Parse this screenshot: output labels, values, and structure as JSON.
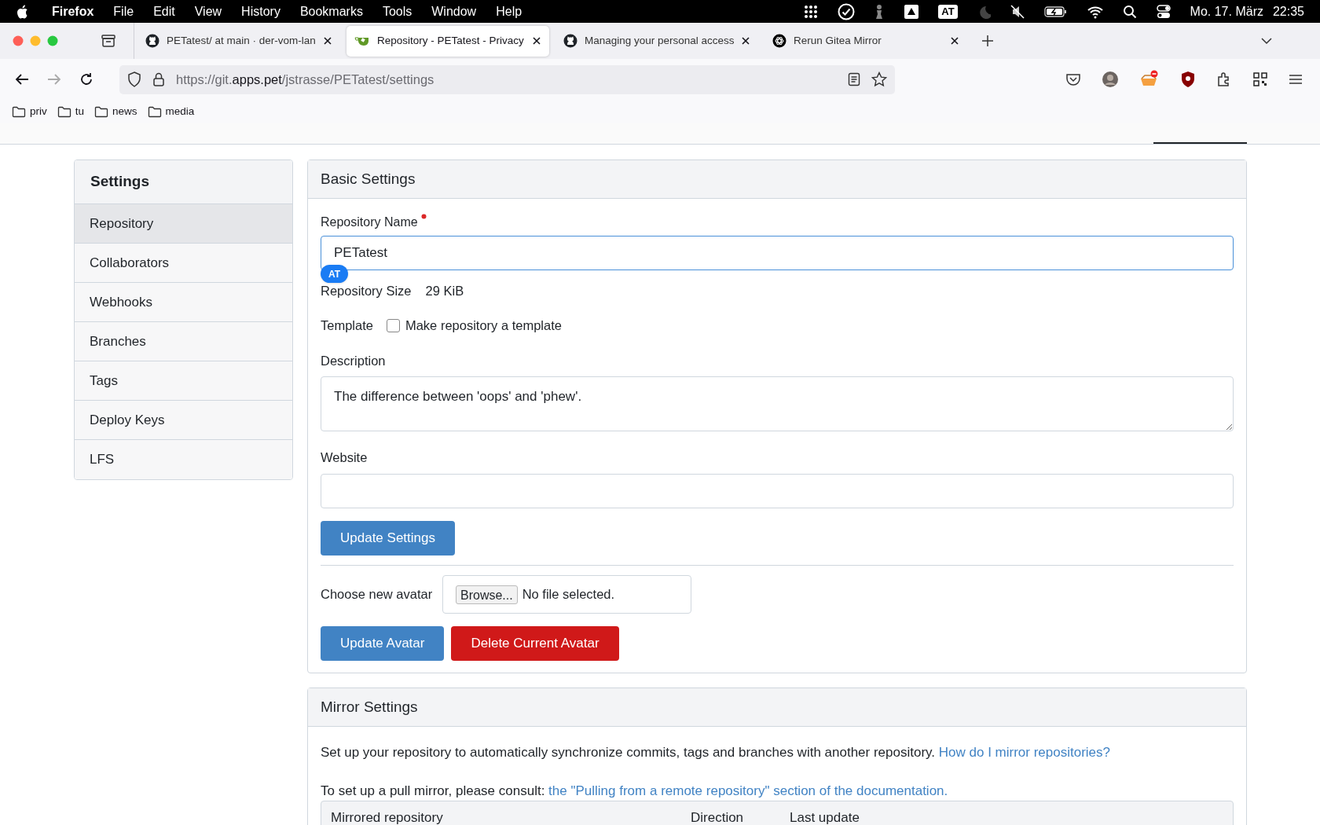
{
  "menu_bar": {
    "app": "Firefox",
    "items": [
      "File",
      "Edit",
      "View",
      "History",
      "Bookmarks",
      "Tools",
      "Window",
      "Help"
    ],
    "status_badge": "AT",
    "date": "Mo. 17. März",
    "time": "22:35"
  },
  "tabs": [
    {
      "title": "PETatest/ at main · der-vom-lan",
      "kind": "github",
      "selected": false
    },
    {
      "title": "Repository - PETatest - Privacy",
      "kind": "gitea",
      "selected": true
    },
    {
      "title": "Managing your personal access",
      "kind": "github",
      "selected": false
    },
    {
      "title": "Rerun Gitea Mirror",
      "kind": "knot",
      "selected": false
    }
  ],
  "address_bar": {
    "prefix": "https://git.",
    "domain": "apps.pet",
    "path": "/jstrasse/PETatest/settings"
  },
  "bookmarks": [
    "priv",
    "tu",
    "news",
    "media"
  ],
  "sidebar": {
    "title": "Settings",
    "items": [
      {
        "label": "Repository",
        "selected": true
      },
      {
        "label": "Collaborators",
        "selected": false
      },
      {
        "label": "Webhooks",
        "selected": false
      },
      {
        "label": "Branches",
        "selected": false
      },
      {
        "label": "Tags",
        "selected": false
      },
      {
        "label": "Deploy Keys",
        "selected": false
      },
      {
        "label": "LFS",
        "selected": false
      }
    ]
  },
  "basic_settings": {
    "title": "Basic Settings",
    "name_label": "Repository Name",
    "required": true,
    "name_value": "PETatest",
    "overlay_badge": "AT",
    "size_label": "Repository Size",
    "size_value": "29 KiB",
    "template_label": "Template",
    "template_checkbox": {
      "label": "Make repository a template",
      "checked": false
    },
    "description_label": "Description",
    "description_value": "The difference between 'oops' and 'phew'.",
    "website_label": "Website",
    "update_button": "Update Settings",
    "avatar_label": "Choose new avatar",
    "browse_button": "Browse...",
    "file_status": "No file selected.",
    "update_avatar_button": "Update Avatar",
    "delete_avatar_button": "Delete Current Avatar"
  },
  "mirror_settings": {
    "title": "Mirror Settings",
    "intro": "Set up your repository to automatically synchronize commits, tags and branches with another repository.",
    "intro_link": "How do I mirror repositories?",
    "pull_text": "To set up a pull mirror, please consult:",
    "pull_link": "the \"Pulling from a remote repository\" section of the documentation.",
    "columns": [
      "Mirrored repository",
      "Direction",
      "Last update"
    ]
  }
}
